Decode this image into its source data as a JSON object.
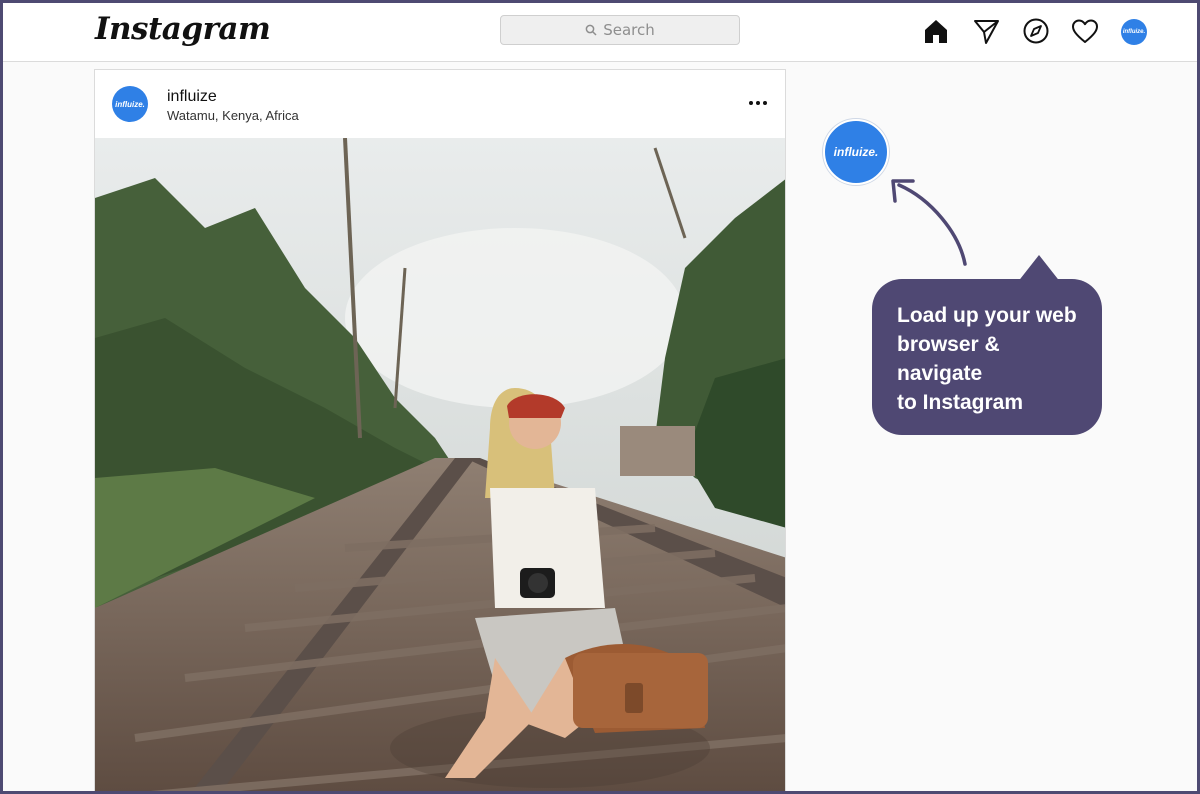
{
  "app": {
    "logo_text": "Instagram"
  },
  "header": {
    "search": {
      "placeholder": "Search"
    },
    "nav": [
      {
        "name": "home",
        "icon": "home-icon"
      },
      {
        "name": "direct",
        "icon": "paper-plane-icon"
      },
      {
        "name": "explore",
        "icon": "compass-icon"
      },
      {
        "name": "activity",
        "icon": "heart-icon"
      },
      {
        "name": "profile",
        "icon": "profile-avatar"
      }
    ],
    "profile_avatar_text": "influize."
  },
  "post": {
    "avatar_text": "influize.",
    "username": "influize",
    "location": "Watamu, Kenya, Africa",
    "more_icon": "more-options-icon",
    "photo_subject": "woman-on-railway-tracks"
  },
  "annotation": {
    "avatar_text": "influize.",
    "callout_lines": [
      "Load up your web",
      "browser &",
      "navigate",
      "to Instagram"
    ],
    "colors": {
      "callout_bg": "#4f4873",
      "arrow": "#4f4873",
      "avatar_bg": "#2f80e6"
    }
  }
}
